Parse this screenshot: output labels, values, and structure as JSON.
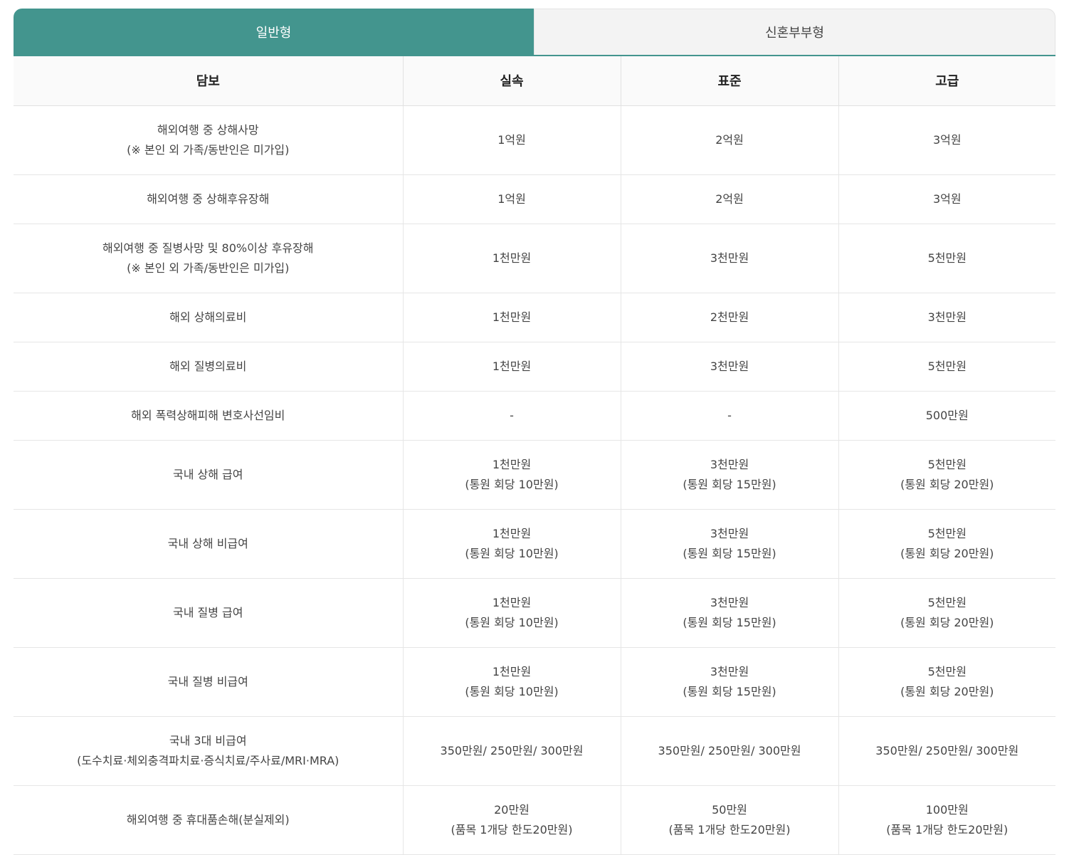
{
  "tabs": [
    {
      "label": "일반형",
      "active": true
    },
    {
      "label": "신혼부부형",
      "active": false
    }
  ],
  "colors": {
    "accent": "#43958e",
    "header_bg": "#fafafa",
    "inactive_tab_bg": "#f3f3f3"
  },
  "table": {
    "headers": [
      "담보",
      "실속",
      "표준",
      "고급"
    ],
    "rows": [
      {
        "coverage": [
          "해외여행 중 상해사망",
          "(※ 본인 외 가족/동반인은 미가입)"
        ],
        "basic": [
          "1억원"
        ],
        "standard": [
          "2억원"
        ],
        "premium": [
          "3억원"
        ]
      },
      {
        "coverage": [
          "해외여행 중 상해후유장해"
        ],
        "basic": [
          "1억원"
        ],
        "standard": [
          "2억원"
        ],
        "premium": [
          "3억원"
        ]
      },
      {
        "coverage": [
          "해외여행 중 질병사망 및 80%이상 후유장해",
          "(※ 본인 외 가족/동반인은 미가입)"
        ],
        "basic": [
          "1천만원"
        ],
        "standard": [
          "3천만원"
        ],
        "premium": [
          "5천만원"
        ]
      },
      {
        "coverage": [
          "해외 상해의료비"
        ],
        "basic": [
          "1천만원"
        ],
        "standard": [
          "2천만원"
        ],
        "premium": [
          "3천만원"
        ]
      },
      {
        "coverage": [
          "해외 질병의료비"
        ],
        "basic": [
          "1천만원"
        ],
        "standard": [
          "3천만원"
        ],
        "premium": [
          "5천만원"
        ]
      },
      {
        "coverage": [
          "해외 폭력상해피해 변호사선임비"
        ],
        "basic": [
          "-"
        ],
        "standard": [
          "-"
        ],
        "premium": [
          "500만원"
        ]
      },
      {
        "coverage": [
          "국내 상해 급여"
        ],
        "basic": [
          "1천만원",
          "(통원 회당 10만원)"
        ],
        "standard": [
          "3천만원",
          "(통원 회당 15만원)"
        ],
        "premium": [
          "5천만원",
          "(통원 회당 20만원)"
        ]
      },
      {
        "coverage": [
          "국내 상해 비급여"
        ],
        "basic": [
          "1천만원",
          "(통원 회당 10만원)"
        ],
        "standard": [
          "3천만원",
          "(통원 회당 15만원)"
        ],
        "premium": [
          "5천만원",
          "(통원 회당 20만원)"
        ]
      },
      {
        "coverage": [
          "국내 질병 급여"
        ],
        "basic": [
          "1천만원",
          "(통원 회당 10만원)"
        ],
        "standard": [
          "3천만원",
          "(통원 회당 15만원)"
        ],
        "premium": [
          "5천만원",
          "(통원 회당 20만원)"
        ]
      },
      {
        "coverage": [
          "국내 질병 비급여"
        ],
        "basic": [
          "1천만원",
          "(통원 회당 10만원)"
        ],
        "standard": [
          "3천만원",
          "(통원 회당 15만원)"
        ],
        "premium": [
          "5천만원",
          "(통원 회당 20만원)"
        ]
      },
      {
        "coverage": [
          "국내 3대 비급여",
          "(도수치료·체외충격파치료·증식치료/주사료/MRI·MRA)"
        ],
        "basic": [
          "350만원/ 250만원/ 300만원"
        ],
        "standard": [
          "350만원/ 250만원/ 300만원"
        ],
        "premium": [
          "350만원/ 250만원/ 300만원"
        ]
      },
      {
        "coverage": [
          "해외여행 중 휴대품손해(분실제외)"
        ],
        "basic": [
          "20만원",
          "(품목 1개당 한도20만원)"
        ],
        "standard": [
          "50만원",
          "(품목 1개당 한도20만원)"
        ],
        "premium": [
          "100만원",
          "(품목 1개당 한도20만원)"
        ]
      }
    ]
  }
}
